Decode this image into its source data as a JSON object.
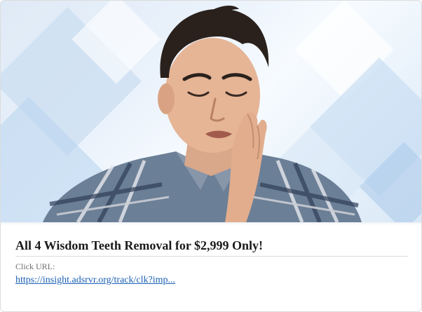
{
  "ad": {
    "image_alt": "Young man holding his cheek in tooth pain",
    "title": "All 4 Wisdom Teeth Removal for $2,999 Only!",
    "click_url_label": "Click URL:",
    "click_url": "https://insight.adsrvr.org/track/clk?imp..."
  },
  "colors": {
    "title": "#1a1a1a",
    "label": "#6f6f6f",
    "link": "#1a5fb4",
    "background_blue": "#c9ddf1"
  }
}
